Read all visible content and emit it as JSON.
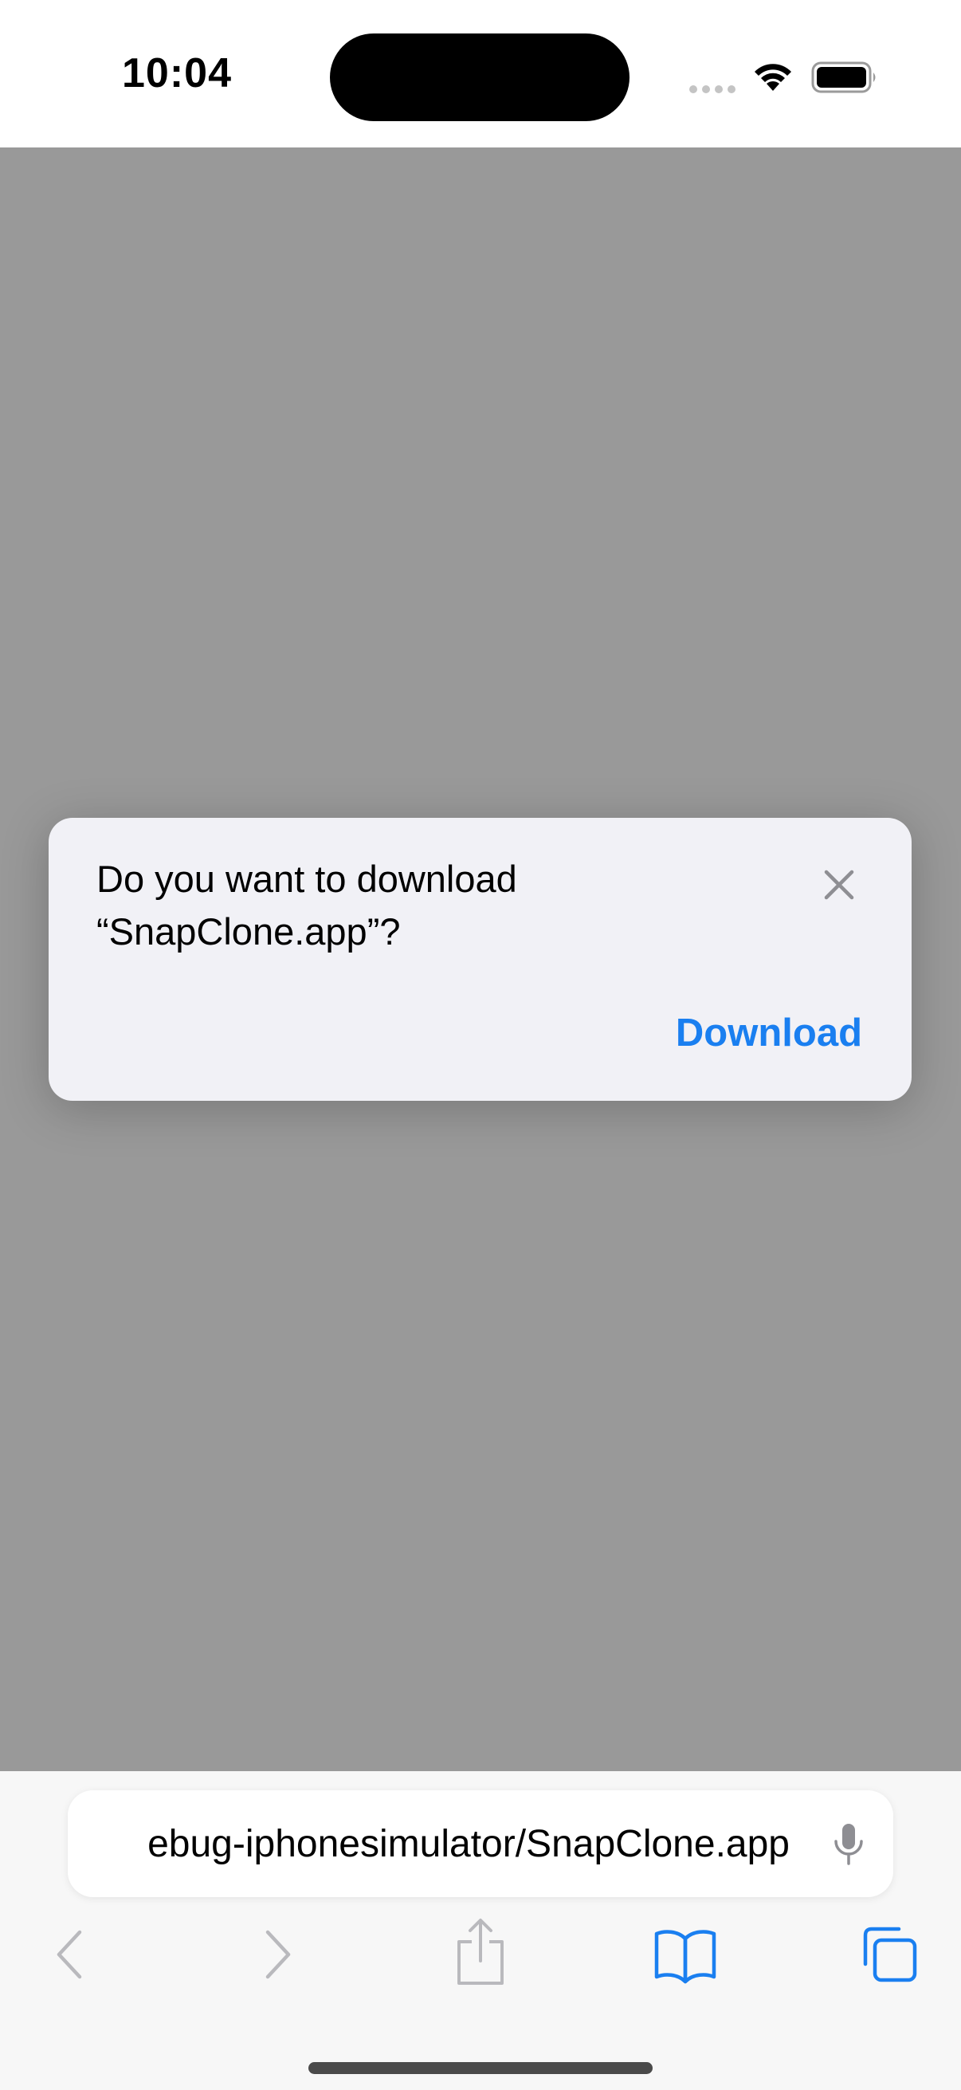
{
  "status_bar": {
    "time": "10:04"
  },
  "download_prompt": {
    "message_line_1": "Do you want to download",
    "message_line_2": "“SnapClone.app”?",
    "download_label": "Download",
    "close_icon": "close-icon"
  },
  "address_bar": {
    "url_visible": "ebug-iphonesimulator/SnapClone.app",
    "mic_icon": "microphone-icon"
  },
  "toolbar": {
    "icons": [
      "back-chevron-icon",
      "forward-chevron-icon",
      "share-icon",
      "bookmarks-book-icon",
      "tabs-icon"
    ]
  },
  "colors": {
    "accent": "#1a7ff0",
    "dim_overlay": "#999999",
    "card_background": "#f1f1f6",
    "disabled_icon": "#b9b9bd"
  }
}
